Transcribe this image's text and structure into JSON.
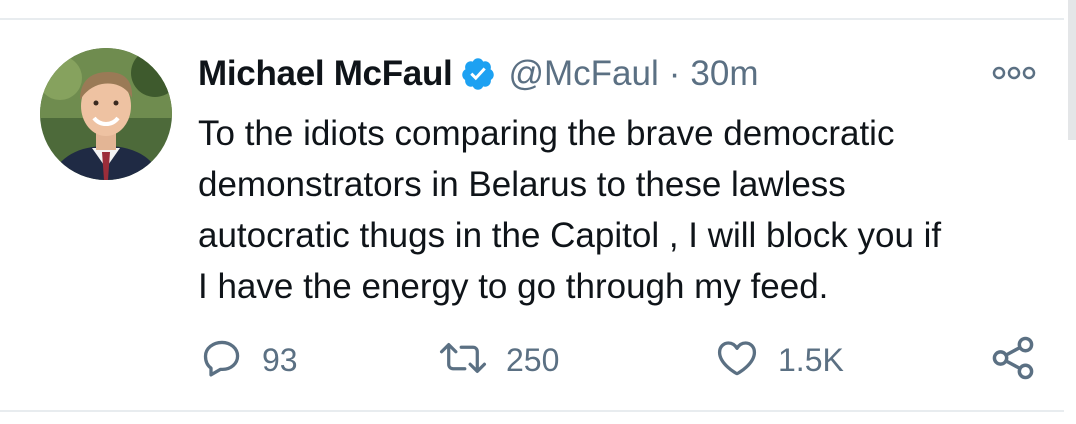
{
  "tweet": {
    "author": {
      "display_name": "Michael McFaul",
      "handle": "@McFaul",
      "verified": true
    },
    "separator": "·",
    "time": "30m",
    "text": "To the idiots comparing the brave democratic\ndemonstrators in Belarus to these lawless\nautocratic thugs in the Capitol , I will block you if\nI have the energy to go through my feed.",
    "stats": {
      "replies": "93",
      "retweets": "250",
      "likes": "1.5K"
    }
  },
  "icons": {
    "verified": "verified-badge-icon",
    "more": "more-options-icon",
    "reply": "reply-icon",
    "retweet": "retweet-icon",
    "like": "heart-icon",
    "share": "share-icon"
  },
  "colors": {
    "verified_blue": "#1da1f2",
    "text_primary": "#0f1419",
    "text_secondary": "#5b7083"
  }
}
